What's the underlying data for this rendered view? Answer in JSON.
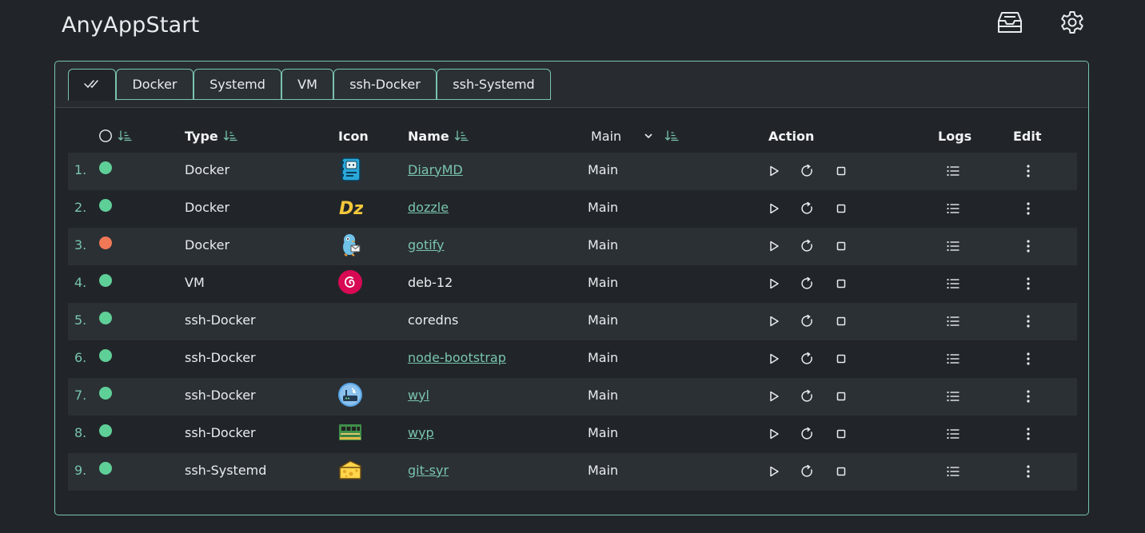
{
  "app": {
    "title": "AnyAppStart"
  },
  "header": {
    "icons": [
      "inbox-tray-icon",
      "gear-icon"
    ]
  },
  "tabs": [
    {
      "label": "",
      "icon": "double-check-icon",
      "active": true
    },
    {
      "label": "Docker"
    },
    {
      "label": "Systemd"
    },
    {
      "label": "VM"
    },
    {
      "label": "ssh-Docker"
    },
    {
      "label": "ssh-Systemd"
    }
  ],
  "table": {
    "headers": {
      "type": "Type",
      "icon": "Icon",
      "name": "Name",
      "main_select": "Main",
      "action": "Action",
      "logs": "Logs",
      "edit": "Edit"
    },
    "rows": [
      {
        "num": "1.",
        "status": "running",
        "status_color": "#5fcf98",
        "type": "Docker",
        "icon": "diarymd-notebook-icon",
        "name": "DiaryMD",
        "linked": true,
        "main": "Main"
      },
      {
        "num": "2.",
        "status": "running",
        "status_color": "#5fcf98",
        "type": "Docker",
        "icon": "dozzle-icon",
        "name": "dozzle",
        "linked": true,
        "main": "Main"
      },
      {
        "num": "3.",
        "status": "stopped",
        "status_color": "#f07856",
        "type": "Docker",
        "icon": "gotify-icon",
        "name": "gotify",
        "linked": true,
        "main": "Main"
      },
      {
        "num": "4.",
        "status": "running",
        "status_color": "#5fcf98",
        "type": "VM",
        "icon": "debian-icon",
        "name": "deb-12",
        "linked": false,
        "main": "Main"
      },
      {
        "num": "5.",
        "status": "running",
        "status_color": "#5fcf98",
        "type": "ssh-Docker",
        "icon": "",
        "name": "coredns",
        "linked": false,
        "main": "Main"
      },
      {
        "num": "6.",
        "status": "running",
        "status_color": "#5fcf98",
        "type": "ssh-Docker",
        "icon": "",
        "name": "node-bootstrap",
        "linked": true,
        "main": "Main"
      },
      {
        "num": "7.",
        "status": "running",
        "status_color": "#5fcf98",
        "type": "ssh-Docker",
        "icon": "wyl-router-icon",
        "name": "wyl",
        "linked": true,
        "main": "Main"
      },
      {
        "num": "8.",
        "status": "running",
        "status_color": "#5fcf98",
        "type": "ssh-Docker",
        "icon": "wyp-ram-icon",
        "name": "wyp",
        "linked": true,
        "main": "Main"
      },
      {
        "num": "9.",
        "status": "running",
        "status_color": "#5fcf98",
        "type": "ssh-Systemd",
        "icon": "git-syr-cheese-icon",
        "name": "git-syr",
        "linked": true,
        "main": "Main"
      }
    ]
  },
  "colors": {
    "accent": "#79c4ad",
    "background": "#212529",
    "stripe": "#2b3035"
  }
}
